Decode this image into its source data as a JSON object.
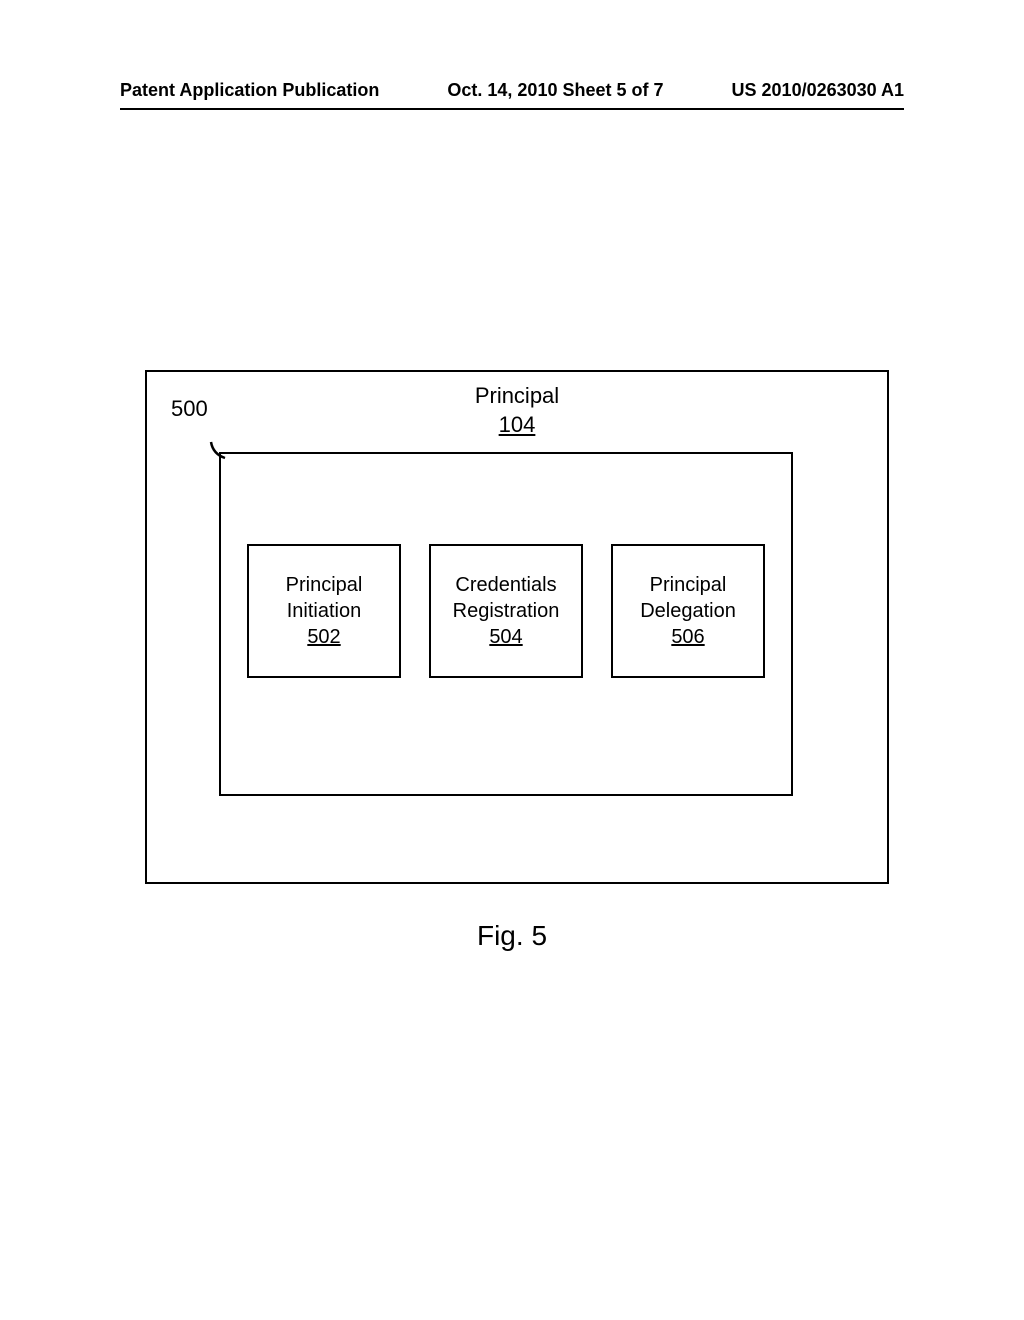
{
  "header": {
    "left": "Patent Application Publication",
    "center": "Oct. 14, 2010  Sheet 5 of 7",
    "right": "US 2010/0263030 A1"
  },
  "diagram": {
    "outer": {
      "title": "Principal",
      "ref": "104"
    },
    "ref500": "500",
    "modules": [
      {
        "line1": "Principal",
        "line2": "Initiation",
        "ref": "502"
      },
      {
        "line1": "Credentials",
        "line2": "Registration",
        "ref": "504"
      },
      {
        "line1": "Principal",
        "line2": "Delegation",
        "ref": "506"
      }
    ]
  },
  "caption": "Fig. 5"
}
